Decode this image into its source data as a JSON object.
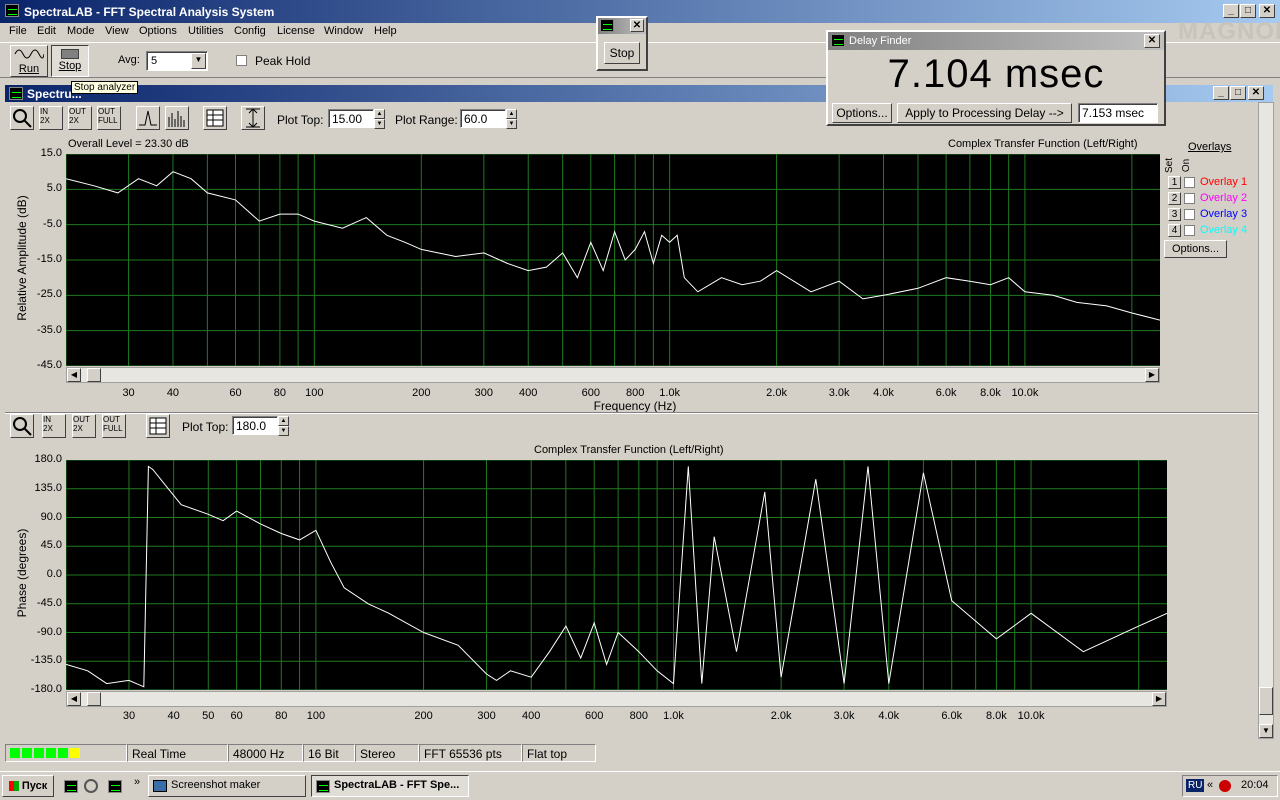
{
  "app": {
    "title": "SpectraLAB - FFT Spectral Analysis System",
    "menu": [
      "File",
      "Edit",
      "Mode",
      "View",
      "Options",
      "Utilities",
      "Config",
      "License",
      "Window",
      "Help"
    ]
  },
  "toolbar": {
    "run_label": "Run",
    "stop_label": "Stop",
    "avg_label": "Avg:",
    "avg_value": "5",
    "peak_hold_label": "Peak Hold",
    "tooltip": "Stop analyzer"
  },
  "stop_popup": {
    "button": "Stop"
  },
  "watermark": "MAGNOLIA",
  "delay_finder": {
    "title": "Delay Finder",
    "value": "7.104 msec",
    "options_button": "Options...",
    "apply_button": "Apply to Processing Delay -->",
    "processing_delay": "7.153 msec"
  },
  "spectrum_window": {
    "title": "Spectru...",
    "plot_top_label": "Plot Top:",
    "plot_top_value": "15.00",
    "plot_range_label": "Plot Range:",
    "plot_range_value": "60.0",
    "overall_level": "Overall Level = 23.30 dB",
    "chart_title": "Complex Transfer Function (Left/Right)",
    "overlays": {
      "header": "Overlays",
      "set_label": "Set",
      "on_label": "On",
      "items": [
        {
          "num": "1",
          "label": "Overlay 1",
          "color": "#ff0000"
        },
        {
          "num": "2",
          "label": "Overlay 2",
          "color": "#ff00ff"
        },
        {
          "num": "3",
          "label": "Overlay 3",
          "color": "#0000ff"
        },
        {
          "num": "4",
          "label": "Overlay 4",
          "color": "#00ffff"
        }
      ],
      "options_button": "Options..."
    }
  },
  "phase_window": {
    "plot_top_label": "Plot Top:",
    "plot_top_value": "180.0",
    "chart_title": "Complex Transfer Function (Left/Right)"
  },
  "status": {
    "mode": "Real Time",
    "rate": "48000 Hz",
    "bits": "16 Bit",
    "channels": "Stereo",
    "fft": "FFT 65536 pts",
    "window": "Flat top"
  },
  "taskbar": {
    "start": "Пуск",
    "tasks": [
      "Screenshot maker",
      "SpectraLAB - FFT Spe..."
    ],
    "lang": "RU",
    "clock": "20:04"
  },
  "chart_data": [
    {
      "type": "line",
      "title": "Complex Transfer Function (Left/Right)",
      "xlabel": "Frequency (Hz)",
      "ylabel": "Relative Amplitude (dB)",
      "xscale": "log",
      "xlim": [
        20,
        24000
      ],
      "ylim": [
        -45,
        15
      ],
      "yticks": [
        "15.0",
        "5.0",
        "-5.0",
        "-15.0",
        "-25.0",
        "-35.0",
        "-45.0"
      ],
      "xticks": [
        "30",
        "40",
        "60",
        "80",
        "100",
        "200",
        "300",
        "400",
        "600",
        "800",
        "1.0k",
        "2.0k",
        "3.0k",
        "4.0k",
        "6.0k",
        "8.0k",
        "10.0k"
      ],
      "grid": true,
      "series": [
        {
          "x": [
            20,
            24,
            28,
            32,
            36,
            40,
            45,
            50,
            60,
            70,
            80,
            90,
            100,
            120,
            140,
            160,
            180,
            200,
            250,
            300,
            350,
            400,
            450,
            500,
            550,
            600,
            650,
            700,
            750,
            800,
            850,
            900,
            950,
            1000,
            1050,
            1100,
            1200,
            1400,
            1600,
            1800,
            2000,
            2500,
            3000,
            3500,
            4000,
            5000,
            6000,
            7000,
            8000,
            9000,
            10000,
            12000,
            14000,
            17000,
            20000,
            24000
          ],
          "y": [
            8,
            6,
            4,
            8,
            6,
            10,
            8,
            4,
            2,
            -4,
            -2,
            -2,
            -4,
            -6,
            -3,
            -8,
            -10,
            -12,
            -14,
            -13,
            -16,
            -18,
            -17,
            -13,
            -20,
            -10,
            -18,
            -7,
            -15,
            -12,
            -7,
            -16,
            -8,
            -10,
            -8,
            -20,
            -24,
            -20,
            -22,
            -21,
            -18,
            -24,
            -21,
            -26,
            -25,
            -23,
            -20,
            -21,
            -22,
            -20,
            -24,
            -25,
            -27,
            -28,
            -30,
            -32
          ]
        }
      ]
    },
    {
      "type": "line",
      "title": "Complex Transfer Function (Left/Right)",
      "ylabel": "Phase (degrees)",
      "xscale": "log",
      "xlim": [
        20,
        24000
      ],
      "ylim": [
        -180,
        180
      ],
      "yticks": [
        "180.0",
        "135.0",
        "90.0",
        "45.0",
        "0.0",
        "-45.0",
        "-90.0",
        "-135.0",
        "-180.0"
      ],
      "xticks": [
        "30",
        "40",
        "50",
        "60",
        "80",
        "100",
        "200",
        "300",
        "400",
        "600",
        "800",
        "1.0k",
        "2.0k",
        "3.0k",
        "4.0k",
        "6.0k",
        "8.0k",
        "10.0k"
      ],
      "grid": true,
      "series": [
        {
          "x": [
            20,
            23,
            26,
            30,
            33,
            34,
            35,
            38,
            42,
            50,
            55,
            60,
            70,
            80,
            90,
            100,
            110,
            120,
            140,
            160,
            200,
            250,
            300,
            320,
            350,
            400,
            450,
            500,
            550,
            600,
            650,
            700,
            800,
            900,
            1000,
            1100,
            1200,
            1300,
            1500,
            1800,
            2000,
            2500,
            3000,
            3500,
            4000,
            5000,
            6000,
            8000,
            10000,
            14000,
            20000,
            24000
          ],
          "y": [
            -140,
            -150,
            -170,
            -165,
            -175,
            170,
            165,
            140,
            110,
            95,
            85,
            100,
            80,
            65,
            55,
            70,
            20,
            -20,
            -45,
            -60,
            -90,
            -110,
            -155,
            -165,
            -150,
            -160,
            -120,
            -80,
            -130,
            -75,
            -140,
            -90,
            -120,
            -150,
            -170,
            170,
            -170,
            60,
            -120,
            130,
            -160,
            150,
            -170,
            170,
            -170,
            160,
            -40,
            -100,
            -60,
            -120,
            -80,
            -60
          ]
        }
      ]
    }
  ]
}
